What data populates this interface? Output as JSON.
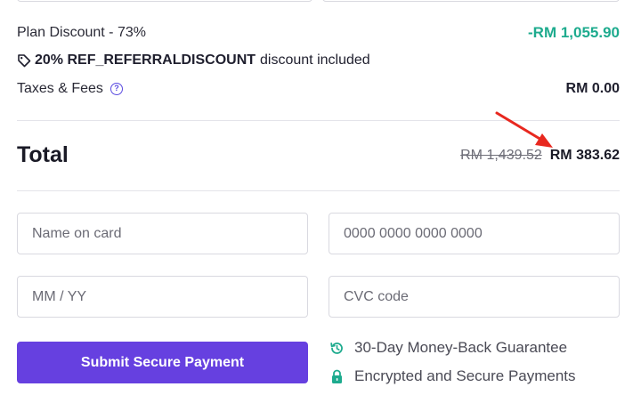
{
  "summary": {
    "plan_discount_label": "Plan Discount - 73%",
    "plan_discount_value": "-RM 1,055.90",
    "coupon_code": "20% REF_REFERRALDISCOUNT",
    "coupon_suffix": "discount included",
    "taxes_label": "Taxes & Fees",
    "taxes_help_glyph": "?",
    "taxes_value": "RM 0.00"
  },
  "total": {
    "label": "Total",
    "original_price": "RM 1,439.52",
    "final_price": "RM 383.62"
  },
  "form": {
    "name_placeholder": "Name on card",
    "card_number_placeholder": "0000 0000 0000 0000",
    "expiry_placeholder": "MM / YY",
    "cvc_placeholder": "CVC code",
    "submit_label": "Submit Secure Payment"
  },
  "assurances": {
    "money_back": "30-Day Money-Back Guarantee",
    "secure": "Encrypted and Secure Payments"
  },
  "colors": {
    "accent": "#6640e0",
    "discount": "#1eab8e",
    "annotation_arrow": "#e8281f"
  },
  "icons": [
    "tag-icon",
    "help-icon",
    "history-icon",
    "lock-icon"
  ]
}
